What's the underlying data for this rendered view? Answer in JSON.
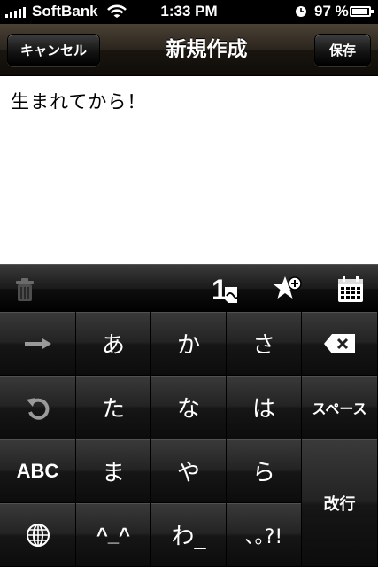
{
  "status_bar": {
    "carrier": "SoftBank",
    "time": "1:33 PM",
    "battery": "97 %",
    "battery_level": 0.97,
    "icons": [
      "signal-icon",
      "wifi-icon",
      "alarm-icon",
      "battery-icon"
    ]
  },
  "nav": {
    "cancel_label": "キャンセル",
    "title": "新規作成",
    "save_label": "保存"
  },
  "editor": {
    "text": "生まれてから！"
  },
  "toolbar": {
    "icons": [
      "trash-icon",
      "day-count-icon",
      "favorite-add-icon",
      "calendar-icon"
    ],
    "day_count_digit": "1"
  },
  "keyboard": {
    "row1": {
      "arrow_icon": "right-arrow-icon",
      "a": "あ",
      "ka": "か",
      "sa": "さ",
      "delete_icon": "backspace-icon"
    },
    "row2": {
      "undo_icon": "undo-icon",
      "ta": "た",
      "na": "な",
      "ha": "は",
      "space": "スペース"
    },
    "row3": {
      "abc": "ABC",
      "ma": "ま",
      "ya": "や",
      "ra": "ら",
      "return": "改行"
    },
    "row4": {
      "globe_icon": "globe-icon",
      "face": "^_^",
      "wa": "わ_",
      "punct": "､｡?!"
    }
  },
  "colors": {
    "nav_gradient_top": "#4b4235",
    "nav_gradient_bottom": "#0f0c08",
    "key_face": "#232323",
    "status_bar": "#000000"
  }
}
